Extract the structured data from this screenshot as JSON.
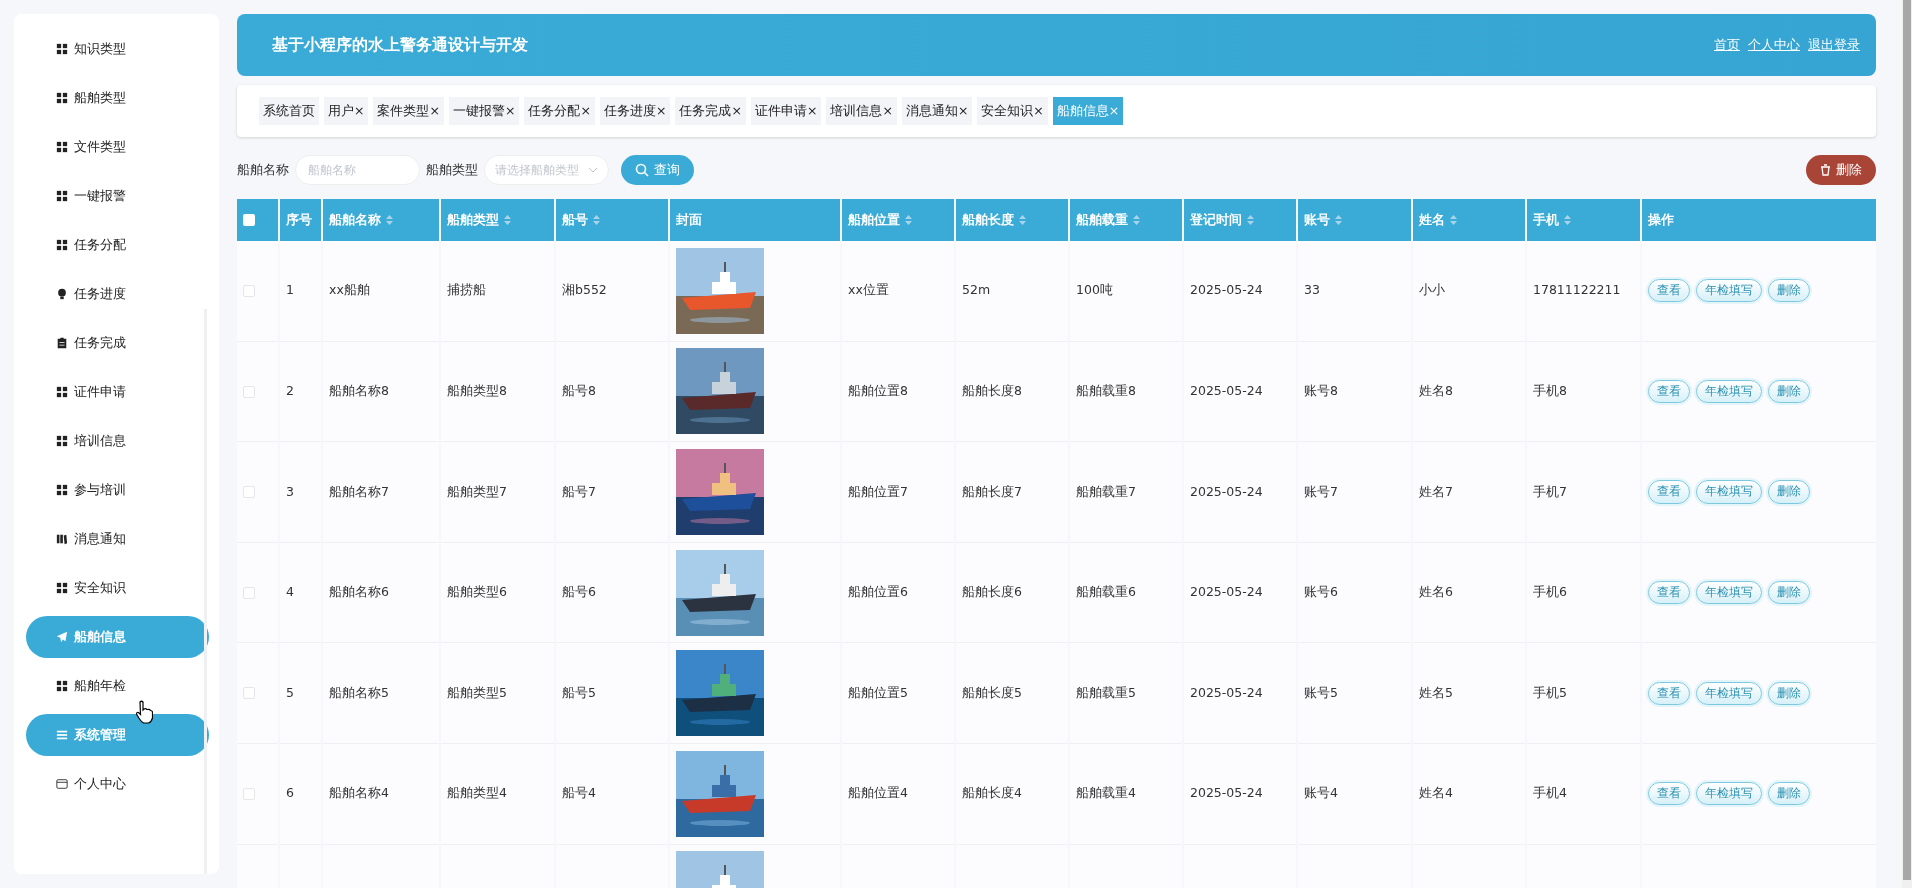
{
  "sidebar": {
    "items": [
      {
        "label": "知识类型",
        "kind": "grid",
        "selected": false
      },
      {
        "label": "船舶类型",
        "kind": "grid",
        "selected": false
      },
      {
        "label": "文件类型",
        "kind": "grid",
        "selected": false
      },
      {
        "label": "一键报警",
        "kind": "grid",
        "selected": false
      },
      {
        "label": "任务分配",
        "kind": "grid",
        "selected": false
      },
      {
        "label": "任务进度",
        "kind": "bulb",
        "selected": false
      },
      {
        "label": "任务完成",
        "kind": "clipboard",
        "selected": false
      },
      {
        "label": "证件申请",
        "kind": "grid",
        "selected": false
      },
      {
        "label": "培训信息",
        "kind": "grid",
        "selected": false
      },
      {
        "label": "参与培训",
        "kind": "grid",
        "selected": false
      },
      {
        "label": "消息通知",
        "kind": "book",
        "selected": false
      },
      {
        "label": "安全知识",
        "kind": "grid",
        "selected": false
      },
      {
        "label": "船舶信息",
        "kind": "send",
        "selected": true
      },
      {
        "label": "船舶年检",
        "kind": "grid",
        "selected": false
      },
      {
        "label": "系统管理",
        "kind": "menu",
        "selected": true
      },
      {
        "label": "个人中心",
        "kind": "wallet",
        "selected": false
      }
    ]
  },
  "header": {
    "title": "基于小程序的水上警务通设计与开发",
    "links": [
      "首页",
      "个人中心",
      "退出登录"
    ]
  },
  "tabs": [
    {
      "label": "系统首页",
      "closable": false,
      "selected": false
    },
    {
      "label": "用户",
      "closable": true,
      "selected": false
    },
    {
      "label": "案件类型",
      "closable": true,
      "selected": false
    },
    {
      "label": "一键报警",
      "closable": true,
      "selected": false
    },
    {
      "label": "任务分配",
      "closable": true,
      "selected": false
    },
    {
      "label": "任务进度",
      "closable": true,
      "selected": false
    },
    {
      "label": "任务完成",
      "closable": true,
      "selected": false
    },
    {
      "label": "证件申请",
      "closable": true,
      "selected": false
    },
    {
      "label": "培训信息",
      "closable": true,
      "selected": false
    },
    {
      "label": "消息通知",
      "closable": true,
      "selected": false
    },
    {
      "label": "安全知识",
      "closable": true,
      "selected": false
    },
    {
      "label": "船舶信息",
      "closable": true,
      "selected": true
    }
  ],
  "tab_close": "×",
  "search": {
    "fields": [
      {
        "label": "船舶名称",
        "kind": "input",
        "placeholder": "船舶名称"
      },
      {
        "label": "船舶类型",
        "kind": "select",
        "placeholder": "请选择船舶类型"
      }
    ],
    "button": "查询",
    "delete_button": "删除"
  },
  "table": {
    "select_all": {
      "checked": false
    },
    "columns": [
      {
        "label": "序号",
        "sortable": false
      },
      {
        "label": "船舶名称",
        "sortable": true
      },
      {
        "label": "船舶类型",
        "sortable": true
      },
      {
        "label": "船号",
        "sortable": true
      },
      {
        "label": "封面",
        "sortable": false
      },
      {
        "label": "船舶位置",
        "sortable": true
      },
      {
        "label": "船舶长度",
        "sortable": true
      },
      {
        "label": "船舶载重",
        "sortable": true
      },
      {
        "label": "登记时间",
        "sortable": true
      },
      {
        "label": "账号",
        "sortable": true
      },
      {
        "label": "姓名",
        "sortable": true
      },
      {
        "label": "手机",
        "sortable": true
      },
      {
        "label": "操作",
        "sortable": false
      }
    ],
    "rows": [
      {
        "checked": false,
        "cells": [
          "1",
          "xx船舶",
          "捕捞船",
          "湘b552",
          null,
          "xx位置",
          "52m",
          "100吨",
          "2025-05-24",
          "33",
          "小小",
          "17811122211"
        ],
        "actions": [
          "查看",
          "年检填写",
          "删除"
        ]
      },
      {
        "checked": false,
        "cells": [
          "2",
          "船舶名称8",
          "船舶类型8",
          "船号8",
          null,
          "船舶位置8",
          "船舶长度8",
          "船舶载重8",
          "2025-05-24",
          "账号8",
          "姓名8",
          "手机8"
        ],
        "actions": [
          "查看",
          "年检填写",
          "删除"
        ]
      },
      {
        "checked": false,
        "cells": [
          "3",
          "船舶名称7",
          "船舶类型7",
          "船号7",
          null,
          "船舶位置7",
          "船舶长度7",
          "船舶载重7",
          "2025-05-24",
          "账号7",
          "姓名7",
          "手机7"
        ],
        "actions": [
          "查看",
          "年检填写",
          "删除"
        ]
      },
      {
        "checked": false,
        "cells": [
          "4",
          "船舶名称6",
          "船舶类型6",
          "船号6",
          null,
          "船舶位置6",
          "船舶长度6",
          "船舶载重6",
          "2025-05-24",
          "账号6",
          "姓名6",
          "手机6"
        ],
        "actions": [
          "查看",
          "年检填写",
          "删除"
        ]
      },
      {
        "checked": false,
        "cells": [
          "5",
          "船舶名称5",
          "船舶类型5",
          "船号5",
          null,
          "船舶位置5",
          "船舶长度5",
          "船舶载重5",
          "2025-05-24",
          "账号5",
          "姓名5",
          "手机5"
        ],
        "actions": [
          "查看",
          "年检填写",
          "删除"
        ]
      },
      {
        "checked": false,
        "cells": [
          "6",
          "船舶名称4",
          "船舶类型4",
          "船号4",
          null,
          "船舶位置4",
          "船舶长度4",
          "船舶载重4",
          "2025-05-24",
          "账号4",
          "姓名4",
          "手机4"
        ],
        "actions": [
          "查看",
          "年检填写",
          "删除"
        ]
      }
    ]
  }
}
